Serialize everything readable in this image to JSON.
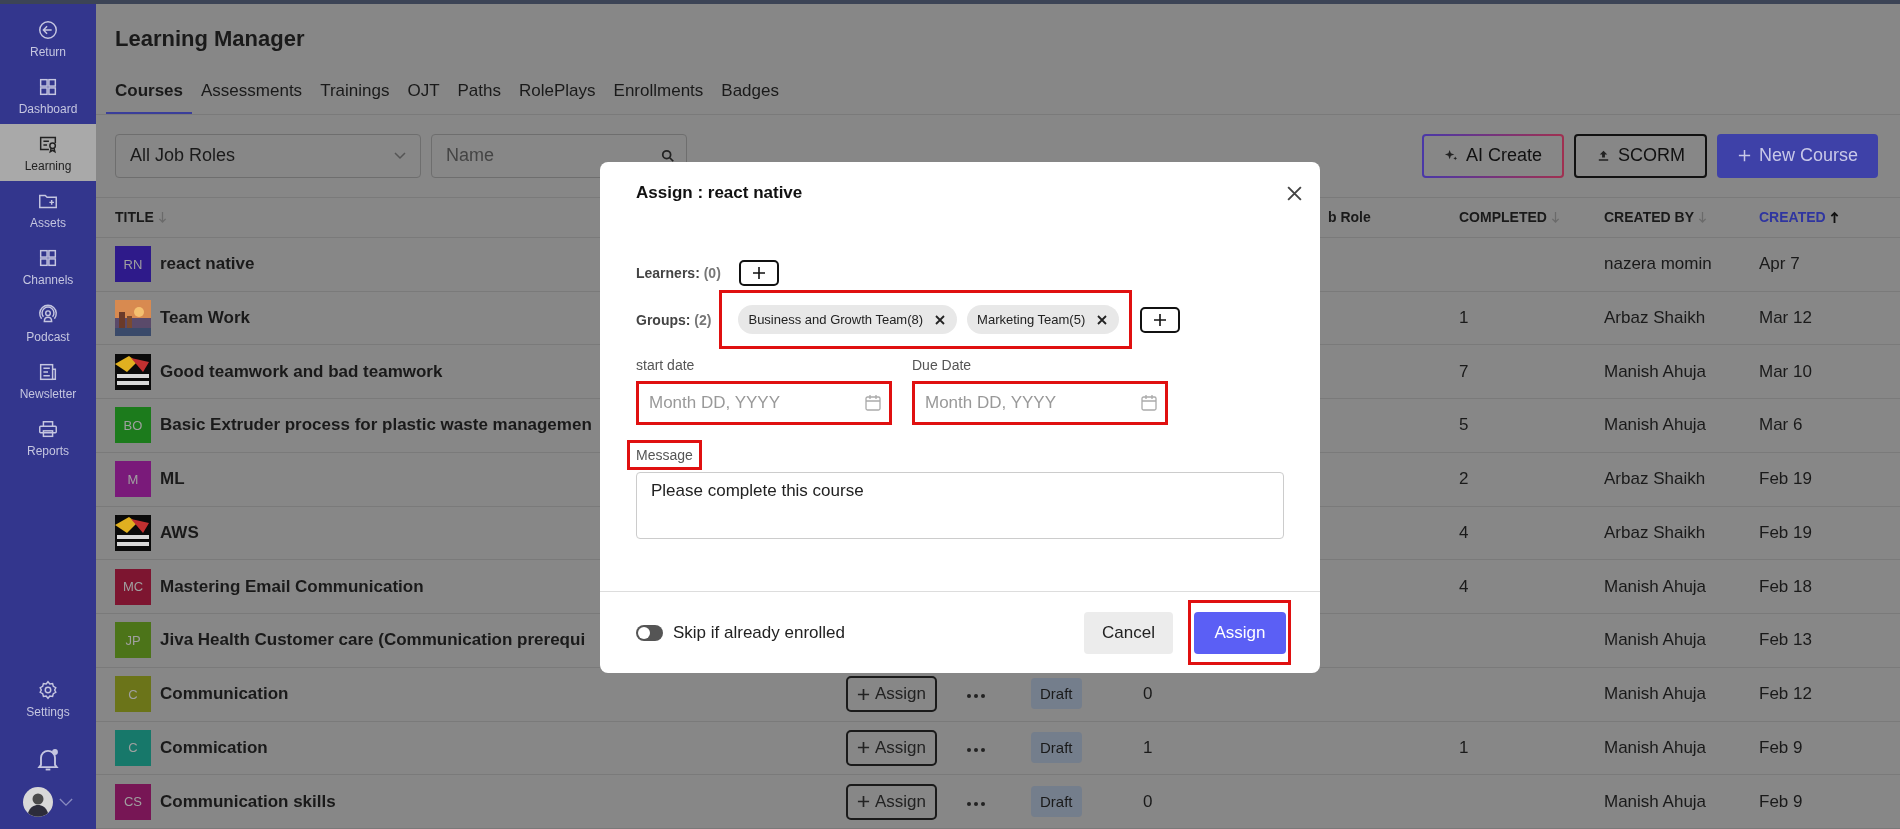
{
  "sidebar": {
    "items": [
      {
        "label": "Return",
        "selected": false
      },
      {
        "label": "Dashboard",
        "selected": false
      },
      {
        "label": "Learning",
        "selected": true
      },
      {
        "label": "Assets",
        "selected": false
      },
      {
        "label": "Channels",
        "selected": false
      },
      {
        "label": "Podcast",
        "selected": false
      },
      {
        "label": "Newsletter",
        "selected": false
      },
      {
        "label": "Reports",
        "selected": false
      }
    ],
    "settings": {
      "label": "Settings"
    },
    "notifications": {
      "unread": true
    }
  },
  "header": {
    "title": "Learning Manager",
    "tabs": [
      {
        "label": "Courses",
        "selected": true
      },
      {
        "label": "Assessments",
        "selected": false
      },
      {
        "label": "Trainings",
        "selected": false
      },
      {
        "label": "OJT",
        "selected": false
      },
      {
        "label": "Paths",
        "selected": false
      },
      {
        "label": "RolePlays",
        "selected": false
      },
      {
        "label": "Enrollments",
        "selected": false
      },
      {
        "label": "Badges",
        "selected": false
      }
    ]
  },
  "filters": {
    "job_role": {
      "value": "All Job Roles"
    },
    "search": {
      "placeholder": "Name"
    }
  },
  "actions": [
    {
      "kind": "ai",
      "label": "AI Create"
    },
    {
      "kind": "upload",
      "label": "SCORM"
    },
    {
      "kind": "primary",
      "label": "New Course"
    }
  ],
  "table": {
    "columns": [
      {
        "label": "TITLE",
        "sorted_ascending": false,
        "active": false
      },
      {
        "label": "b Role"
      },
      {
        "label": "COMPLETED",
        "sorted_ascending": false,
        "active": false
      },
      {
        "label": "CREATED BY",
        "sorted_ascending": false,
        "active": false
      },
      {
        "label": "CREATED",
        "sorted_ascending": true,
        "active": true
      }
    ],
    "rows": [
      {
        "thumb": {
          "kind": "initials",
          "initials": "RN",
          "color": "#2e1a8a"
        },
        "title": "react native",
        "created_by": "nazera momin",
        "created": "Apr 7"
      },
      {
        "title": "Team Work",
        "completed": "1",
        "created_by": "Arbaz Shaikh",
        "created": "Mar 12"
      },
      {
        "title": "Good teamwork and bad teamwork",
        "completed": "7",
        "created_by": "Manish Ahuja",
        "created": "Mar 10"
      },
      {
        "thumb": {
          "kind": "initials",
          "initials": "BO",
          "color": "#1c7b1c"
        },
        "title": "Basic Extruder process for plastic waste managemen",
        "completed": "5",
        "created_by": "Manish Ahuja",
        "created": "Mar 6"
      },
      {
        "thumb": {
          "kind": "initials",
          "initials": "M",
          "color": "#7a1a7a"
        },
        "title": "ML",
        "completed": "2",
        "created_by": "Arbaz Shaikh",
        "created": "Feb 19"
      },
      {
        "title": "AWS",
        "completed": "4",
        "created_by": "Arbaz Shaikh",
        "created": "Feb 19"
      },
      {
        "thumb": {
          "kind": "initials",
          "initials": "MC",
          "color": "#7d1530"
        },
        "title": "Mastering Email Communication",
        "completed": "4",
        "created_by": "Manish Ahuja",
        "created": "Feb 18"
      },
      {
        "thumb": {
          "kind": "initials",
          "initials": "JP",
          "color": "#4c7419"
        },
        "title": "Jiva Health Customer care (Communication prerequi",
        "created_by": "Manish Ahuja",
        "created": "Feb 13"
      },
      {
        "thumb": {
          "kind": "initials",
          "initials": "C",
          "color": "#6b7419"
        },
        "title": "Communication",
        "assign": "Assign",
        "status": "Draft",
        "column_5": "0",
        "created_by": "Manish Ahuja",
        "created": "Feb 12"
      },
      {
        "thumb": {
          "kind": "initials",
          "initials": "C",
          "color": "#17786a"
        },
        "title": "Commication",
        "assign": "Assign",
        "status": "Draft",
        "column_5": "1",
        "completed": "1",
        "created_by": "Manish Ahuja",
        "created": "Feb 9"
      },
      {
        "thumb": {
          "kind": "initials",
          "initials": "CS",
          "color": "#771655"
        },
        "title": "Communication skills",
        "assign": "Assign",
        "status": "Draft",
        "column_5": "0",
        "created_by": "Manish Ahuja",
        "created": "Feb 9"
      }
    ]
  },
  "modal": {
    "title": "Assign : react native",
    "learners": {
      "label": "Learners:",
      "count": "(0)"
    },
    "groups": {
      "label": "Groups:",
      "count": "(2)",
      "highlighted": true,
      "chips": [
        {
          "label": "Business and Growth Team(8)"
        },
        {
          "label": "Marketing Team(5)"
        }
      ]
    },
    "start_date": {
      "label": "start date",
      "placeholder": "Month DD, YYYY",
      "highlighted": true
    },
    "due_date": {
      "label": "Due Date",
      "placeholder": "Month DD, YYYY",
      "highlighted": true
    },
    "message": {
      "label": "Message",
      "label_highlighted": true,
      "value": "Please complete this course"
    },
    "skip_toggle": {
      "label": "Skip if already enrolled",
      "on": false
    },
    "buttons": [
      {
        "kind": "secondary",
        "label": "Cancel",
        "highlighted": false
      },
      {
        "kind": "primary",
        "label": "Assign",
        "highlighted": true
      }
    ]
  }
}
